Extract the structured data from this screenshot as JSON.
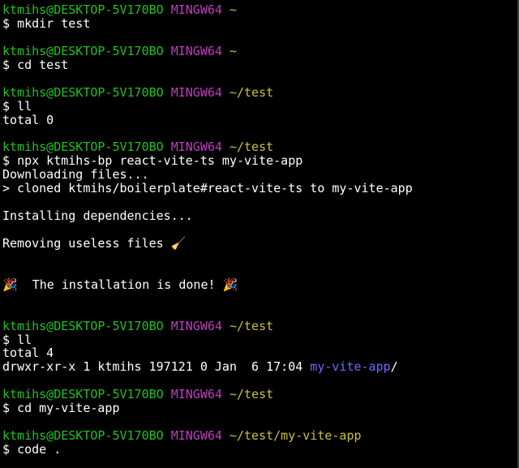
{
  "colors": {
    "background": "#000000",
    "text": "#ffffff",
    "user_host": "#1ec31e",
    "mingw": "#c23bc2",
    "path": "#c7c23a",
    "directory": "#6b6bff"
  },
  "prompt": {
    "user_host": "ktmihs@DESKTOP-5V170BO",
    "env": "MINGW64",
    "symbol": "$"
  },
  "lines": [
    {
      "type": "prompt",
      "path": "~"
    },
    {
      "type": "cmd",
      "text": "mkdir test"
    },
    {
      "type": "blank"
    },
    {
      "type": "prompt",
      "path": "~"
    },
    {
      "type": "cmd",
      "text": "cd test"
    },
    {
      "type": "blank"
    },
    {
      "type": "prompt",
      "path": "~/test"
    },
    {
      "type": "cmd",
      "text": "ll"
    },
    {
      "type": "out",
      "text": "total 0"
    },
    {
      "type": "blank"
    },
    {
      "type": "prompt",
      "path": "~/test"
    },
    {
      "type": "cmd",
      "text": "npx ktmihs-bp react-vite-ts my-vite-app"
    },
    {
      "type": "out",
      "text": "Downloading files..."
    },
    {
      "type": "out",
      "text": "> cloned ktmihs/boilerplate#react-vite-ts to my-vite-app"
    },
    {
      "type": "blank"
    },
    {
      "type": "out",
      "text": "Installing dependencies..."
    },
    {
      "type": "blank"
    },
    {
      "type": "out",
      "text": "Removing useless files 🧹"
    },
    {
      "type": "blank"
    },
    {
      "type": "blank"
    },
    {
      "type": "out",
      "text": "🎉  The installation is done! 🎉"
    },
    {
      "type": "blank"
    },
    {
      "type": "blank"
    },
    {
      "type": "prompt",
      "path": "~/test"
    },
    {
      "type": "cmd",
      "text": "ll"
    },
    {
      "type": "out",
      "text": "total 4"
    },
    {
      "type": "listing",
      "text": "drwxr-xr-x 1 ktmihs 197121 0 Jan  6 17:04 ",
      "dir": "my-vite-app",
      "suffix": "/"
    },
    {
      "type": "blank"
    },
    {
      "type": "prompt",
      "path": "~/test"
    },
    {
      "type": "cmd",
      "text": "cd my-vite-app"
    },
    {
      "type": "blank"
    },
    {
      "type": "prompt",
      "path": "~/test/my-vite-app"
    },
    {
      "type": "cmd",
      "text": "code ."
    }
  ]
}
